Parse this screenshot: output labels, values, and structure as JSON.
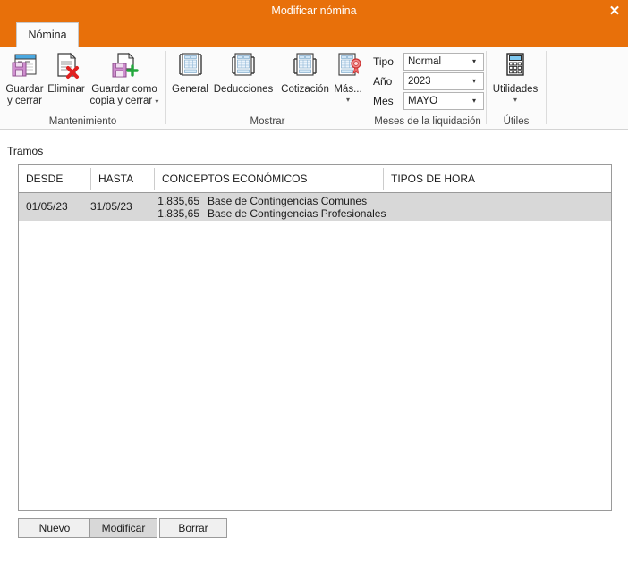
{
  "window": {
    "title": "Modificar nómina",
    "close_label": "✕",
    "accent_color": "#E8700A"
  },
  "tabs": [
    {
      "label": "Nómina",
      "active": true
    }
  ],
  "ribbon": {
    "groups": [
      {
        "name": "mantenimiento",
        "label": "Mantenimiento",
        "buttons": [
          {
            "name": "guardar-y-cerrar",
            "label_line1": "Guardar",
            "label_line2": "y cerrar",
            "icon": "save-window-icon",
            "has_caret": false
          },
          {
            "name": "eliminar",
            "label_line1": "Eliminar",
            "label_line2": "",
            "icon": "document-delete-icon",
            "has_caret": false
          },
          {
            "name": "guardar-como-copia-y-cerrar",
            "label_line1": "Guardar como",
            "label_line2": "copia y cerrar",
            "icon": "save-copy-icon",
            "has_caret": true,
            "caret_inline": "▾"
          }
        ]
      },
      {
        "name": "mostrar",
        "label": "Mostrar",
        "buttons": [
          {
            "name": "general",
            "label_line1": "General",
            "label_line2": "",
            "icon": "report-icon",
            "has_caret": false
          },
          {
            "name": "deducciones",
            "label_line1": "Deducciones",
            "label_line2": "",
            "icon": "report-icon",
            "has_caret": false
          },
          {
            "name": "cotizacion",
            "label_line1": "Cotización",
            "label_line2": "",
            "icon": "report-icon",
            "has_caret": false
          },
          {
            "name": "mas",
            "label_line1": "Más...",
            "label_line2": "",
            "icon": "report-seal-icon",
            "has_caret": true,
            "caret_glyph": "▾"
          }
        ]
      },
      {
        "name": "meses-de-la-liquidacion",
        "label": "Meses de la liquidación",
        "fields": [
          {
            "name": "tipo",
            "label": "Tipo",
            "value": "Normal",
            "arrow": "▾"
          },
          {
            "name": "anio",
            "label": "Año",
            "value": "2023",
            "arrow": "▾"
          },
          {
            "name": "mes",
            "label": "Mes",
            "value": "MAYO",
            "arrow": "▾"
          }
        ]
      },
      {
        "name": "utiles",
        "label": "Útiles",
        "buttons": [
          {
            "name": "utilidades",
            "label_line1": "Utilidades",
            "label_line2": "",
            "icon": "calculator-icon",
            "has_caret": true,
            "caret_glyph": "▾"
          }
        ]
      }
    ]
  },
  "main": {
    "section_label": "Tramos",
    "grid": {
      "columns": [
        {
          "key": "desde",
          "label": "DESDE"
        },
        {
          "key": "hasta",
          "label": "HASTA"
        },
        {
          "key": "conceptos",
          "label": "CONCEPTOS ECONÓMICOS"
        },
        {
          "key": "tipos_hora",
          "label": "TIPOS DE HORA"
        }
      ],
      "rows": [
        {
          "selected": true,
          "desde": "01/05/23",
          "hasta": "31/05/23",
          "conceptos": [
            {
              "amount": "1.835,65",
              "description": "Base de Contingencias Comunes"
            },
            {
              "amount": "1.835,65",
              "description": "Base de Contingencias Profesionales"
            }
          ],
          "tipos_hora": ""
        }
      ]
    }
  },
  "footer": {
    "buttons": [
      {
        "name": "nuevo",
        "label": "Nuevo",
        "state": "normal"
      },
      {
        "name": "modificar",
        "label": "Modificar",
        "state": "hovered"
      },
      {
        "name": "borrar",
        "label": "Borrar",
        "state": "normal"
      }
    ]
  }
}
